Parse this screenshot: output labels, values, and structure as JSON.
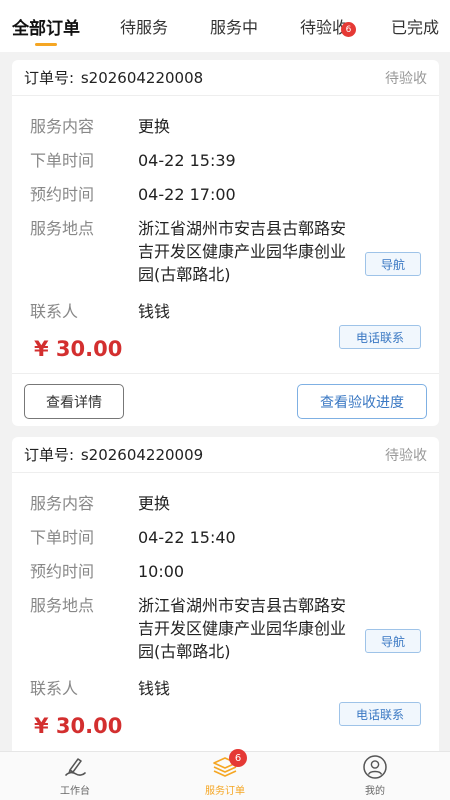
{
  "tabs": [
    {
      "label": "全部订单",
      "active": true
    },
    {
      "label": "待服务"
    },
    {
      "label": "服务中"
    },
    {
      "label": "待验收",
      "badge": "6"
    },
    {
      "label": "已完成"
    }
  ],
  "orders": [
    {
      "order_label": "订单号:",
      "order_no": "s202604220008",
      "status": "待验收",
      "service_label": "服务内容",
      "service": "更换",
      "order_time_label": "下单时间",
      "order_time": "04-22 15:39",
      "appt_time_label": "预约时间",
      "appt_time": "04-22 17:00",
      "address_label": "服务地点",
      "address": "浙江省湖州市安吉县古鄣路安吉开发区健康产业园华康创业园(古鄣路北)",
      "nav_btn": "导航",
      "contact_label": "联系人",
      "contact": "钱钱",
      "call_btn": "电话联系",
      "price": "¥ 30.00",
      "detail_btn": "查看详情",
      "progress_btn": "查看验收进度"
    },
    {
      "order_label": "订单号:",
      "order_no": "s202604220009",
      "status": "待验收",
      "service_label": "服务内容",
      "service": "更换",
      "order_time_label": "下单时间",
      "order_time": "04-22 15:40",
      "appt_time_label": "预约时间",
      "appt_time": "10:00",
      "address_label": "服务地点",
      "address": "浙江省湖州市安吉县古鄣路安吉开发区健康产业园华康创业园(古鄣路北)",
      "nav_btn": "导航",
      "contact_label": "联系人",
      "contact": "钱钱",
      "call_btn": "电话联系",
      "price": "¥ 30.00"
    }
  ],
  "bottom_nav": [
    {
      "label": "工作台",
      "icon": "workbench-icon"
    },
    {
      "label": "服务订单",
      "icon": "orders-icon",
      "badge": "6",
      "active": true
    },
    {
      "label": "我的",
      "icon": "profile-icon"
    }
  ],
  "colors": {
    "accent": "#f5a623",
    "price": "#d32f2f",
    "link_blue": "#3a78c3",
    "badge_red": "#e53935"
  }
}
